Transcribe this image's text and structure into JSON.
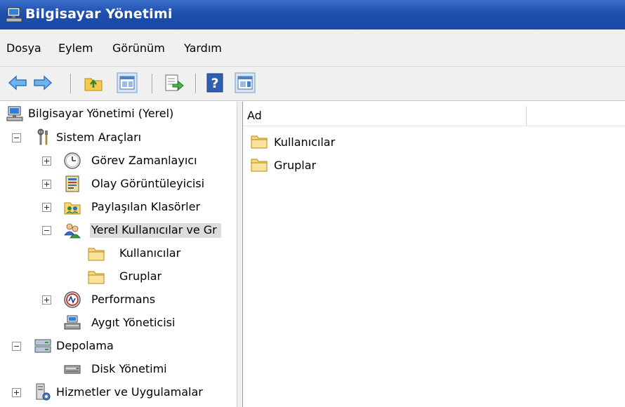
{
  "window": {
    "title": "Bilgisayar Yönetimi"
  },
  "menu": {
    "items": [
      "Dosya",
      "Eylem",
      "Görünüm",
      "Yardım"
    ]
  },
  "toolbar": {
    "buttons": [
      "back-icon",
      "forward-icon",
      "up-folder-icon",
      "show-hide-console-tree-icon",
      "export-list-icon",
      "help-icon",
      "show-hide-action-pane-icon"
    ]
  },
  "tree": {
    "root": "Bilgisayar Yönetimi (Yerel)",
    "system_tools": "Sistem Araçları",
    "task_scheduler": "Görev Zamanlayıcı",
    "event_viewer": "Olay Görüntüleyicisi",
    "shared_folders": "Paylaşılan Klasörler",
    "local_users": "Yerel Kullanıcılar ve Gr",
    "users": "Kullanıcılar",
    "groups": "Gruplar",
    "performance": "Performans",
    "device_manager": "Aygıt Yöneticisi",
    "storage": "Depolama",
    "disk_management": "Disk Yönetimi",
    "services_apps": "Hizmetler ve Uygulamalar"
  },
  "list": {
    "columns": [
      "Ad",
      ""
    ],
    "items": [
      "Kullanıcılar",
      "Gruplar"
    ]
  },
  "colors": {
    "titlebar": "#1e4fae",
    "selection": "#dcdcdc",
    "folder": "#f6d77a"
  }
}
